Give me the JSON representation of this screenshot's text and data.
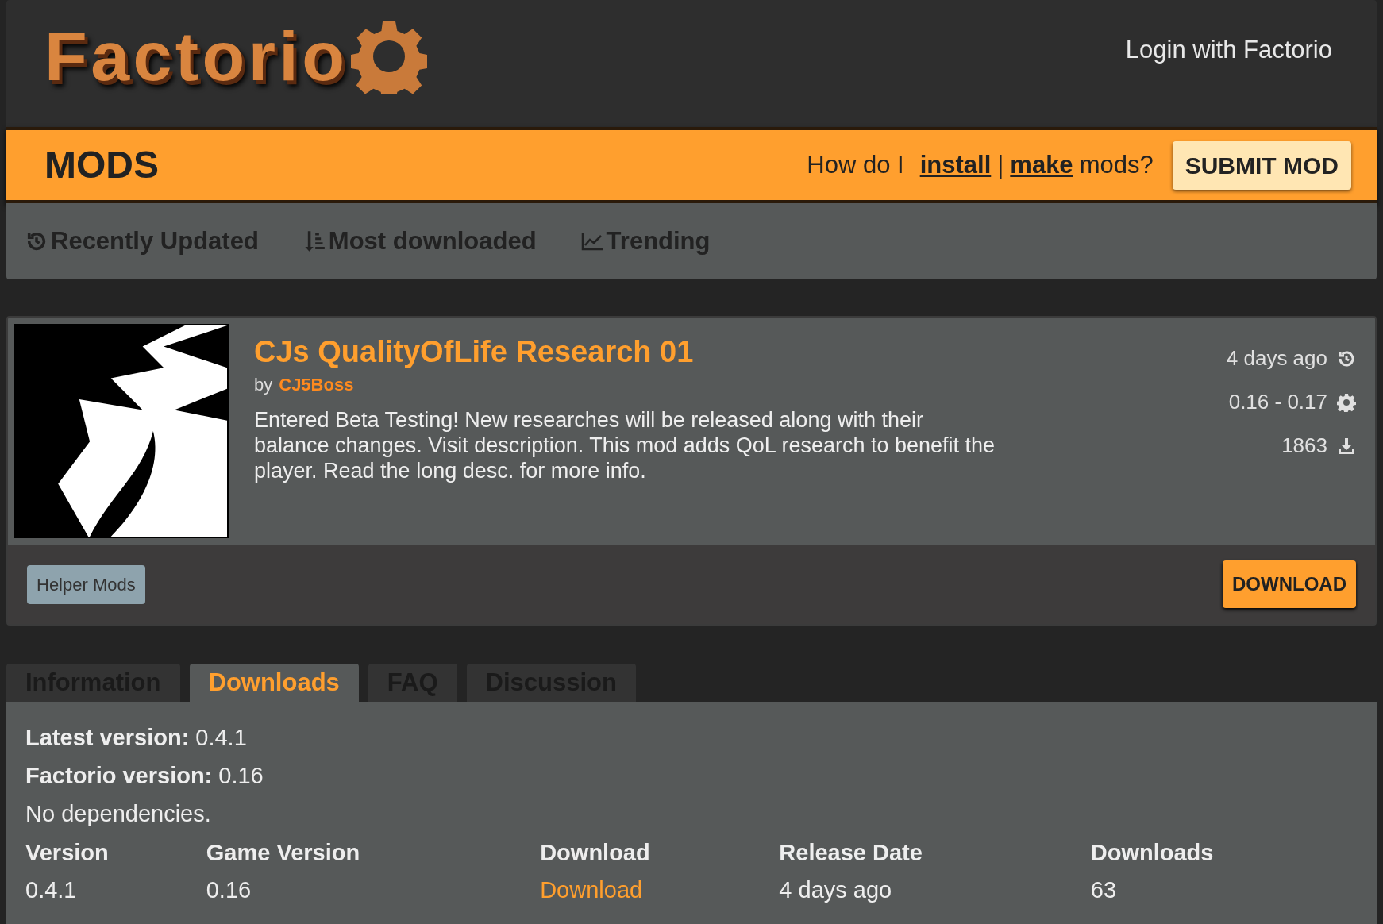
{
  "header": {
    "logo": "Factorio",
    "login": "Login with Factorio"
  },
  "mods_bar": {
    "title": "MODS",
    "question_start": "How do I",
    "install_link": "install",
    "separator": "|",
    "make_link": "make",
    "question_end": "mods?",
    "submit_button": "SUBMIT MOD"
  },
  "sort_nav": [
    {
      "label": "Recently Updated",
      "kind": "recent"
    },
    {
      "label": "Most downloaded",
      "kind": "downloads"
    },
    {
      "label": "Trending",
      "kind": "trending"
    }
  ],
  "mod": {
    "title": "CJs QualityOfLife Research 01",
    "by": "by",
    "author": "CJ5Boss",
    "summary": "Entered Beta Testing! New researches will be released along with their balance changes. Visit description. This mod adds QoL research to benefit the player. Read the long desc. for more info.",
    "stats": [
      {
        "text": "4 days ago",
        "kind": "updated"
      },
      {
        "text": "0.16 - 0.17",
        "kind": "version"
      },
      {
        "text": "1863",
        "kind": "downloads"
      }
    ],
    "tag": "Helper Mods",
    "download_button": "DOWNLOAD"
  },
  "tabs": [
    {
      "label": "Information",
      "selected": false
    },
    {
      "label": "Downloads",
      "selected": true
    },
    {
      "label": "FAQ",
      "selected": false
    },
    {
      "label": "Discussion",
      "selected": false
    }
  ],
  "downloads": {
    "info": [
      {
        "label": "Latest version:",
        "value": "0.4.1"
      },
      {
        "label": "Factorio version:",
        "value": "0.16"
      }
    ],
    "dependencies": "No dependencies.",
    "table": {
      "columns": [
        "Version",
        "Game Version",
        "Download",
        "Release Date",
        "Downloads"
      ],
      "rows": [
        [
          "0.4.1",
          "0.16",
          "Download",
          "4 days ago",
          "63"
        ]
      ]
    }
  }
}
